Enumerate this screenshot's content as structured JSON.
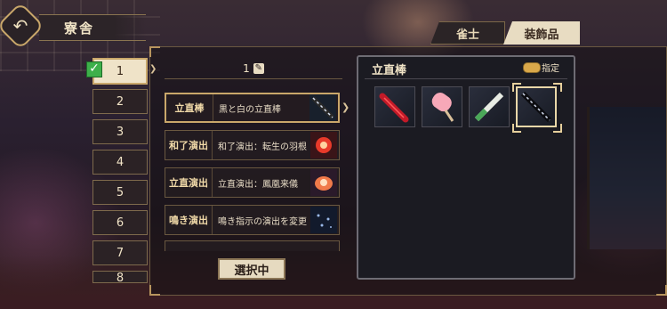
{
  "header": {
    "title": "寮舎",
    "back_icon": "back-arrow-icon"
  },
  "tabs": [
    {
      "label": "雀士",
      "active": false
    },
    {
      "label": "装飾品",
      "active": true
    }
  ],
  "ranks": [
    "1",
    "2",
    "3",
    "4",
    "5",
    "6",
    "7",
    "8"
  ],
  "selected_rank": "1",
  "page": {
    "number": "1",
    "edit_icon": "edit-icon"
  },
  "items": [
    {
      "category": "立直棒",
      "desc": "黒と白の立直棒",
      "icon": "riichi-stick-icon"
    },
    {
      "category": "和了演出",
      "desc": "和了演出：転生の羽根",
      "icon": "win-effect-icon"
    },
    {
      "category": "立直演出",
      "desc": "立直演出：鳳凰来儀",
      "icon": "riichi-effect-icon"
    },
    {
      "category": "鳴き演出",
      "desc": "鳴き指示の演出を変更",
      "icon": "call-effect-icon"
    }
  ],
  "select_button": "選択中",
  "right_panel": {
    "title": "立直棒",
    "toggle_label": "指定",
    "toggle_color": "#d9a84a",
    "tiles": [
      {
        "name": "red-stick",
        "selected": false
      },
      {
        "name": "popsicle-stick",
        "selected": false
      },
      {
        "name": "green-white-stick",
        "selected": false
      },
      {
        "name": "black-white-stick",
        "selected": true
      }
    ]
  },
  "colors": {
    "accent_gold": "#c9a76a",
    "cream": "#efe3c8",
    "check_green": "#3db04a"
  }
}
